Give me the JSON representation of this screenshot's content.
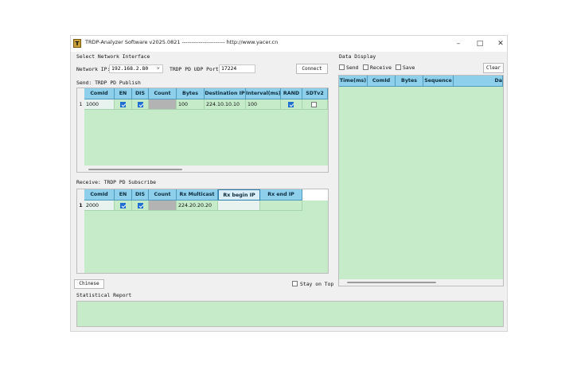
{
  "window": {
    "title": "TRDP-Analyzer Software v2025.0821 ----------------------- http://www.yacer.cn",
    "app_icon_glyph": "T",
    "minimize_glyph": "–",
    "maximize_glyph": "□",
    "close_glyph": "✕"
  },
  "network": {
    "section_label": "Select Network Interface",
    "ip_label": "Network IP:",
    "ip_value": "192.168.2.80",
    "port_label": "TRDP PD UDP Port:",
    "port_value": "17224",
    "connect_label": "Connect",
    "dropdown_glyph": "⌄"
  },
  "send": {
    "section_label": "Send: TRDP PD Publish",
    "columns": [
      "ComId",
      "EN",
      "DIS",
      "Count",
      "Bytes",
      "Destination IP",
      "Interval(ms)",
      "RAND",
      "SDTv2"
    ],
    "rows": [
      {
        "index": "1",
        "comid": "1000",
        "count": "",
        "bytes": "100",
        "dest_ip": "224.10.10.10",
        "interval": "100"
      }
    ]
  },
  "receive": {
    "section_label": "Receive: TRDP PD Subscribe",
    "columns": [
      "ComId",
      "EN",
      "DIS",
      "Count",
      "Rx Multicast",
      "Rx begin IP",
      "Rx end IP"
    ],
    "rows": [
      {
        "index": "1",
        "comid": "2000",
        "count": "",
        "multicast": "224.20.20.20",
        "begin_ip": "",
        "end_ip": ""
      }
    ]
  },
  "bottom": {
    "language_label": "Chinese",
    "stay_on_top_label": "Stay on Top",
    "stat_label": "Statistical Report"
  },
  "display": {
    "section_label": "Data Display",
    "send_label": "Send",
    "receive_label": "Receive",
    "save_label": "Save",
    "clear_label": "Clear",
    "columns": [
      "Time(ms)",
      "ComId",
      "Bytes",
      "Sequence",
      "Da"
    ]
  },
  "colors": {
    "header_blue": "#8ed0ec",
    "grid_green": "#c6ebc9",
    "check_blue": "#1f6fd1"
  }
}
